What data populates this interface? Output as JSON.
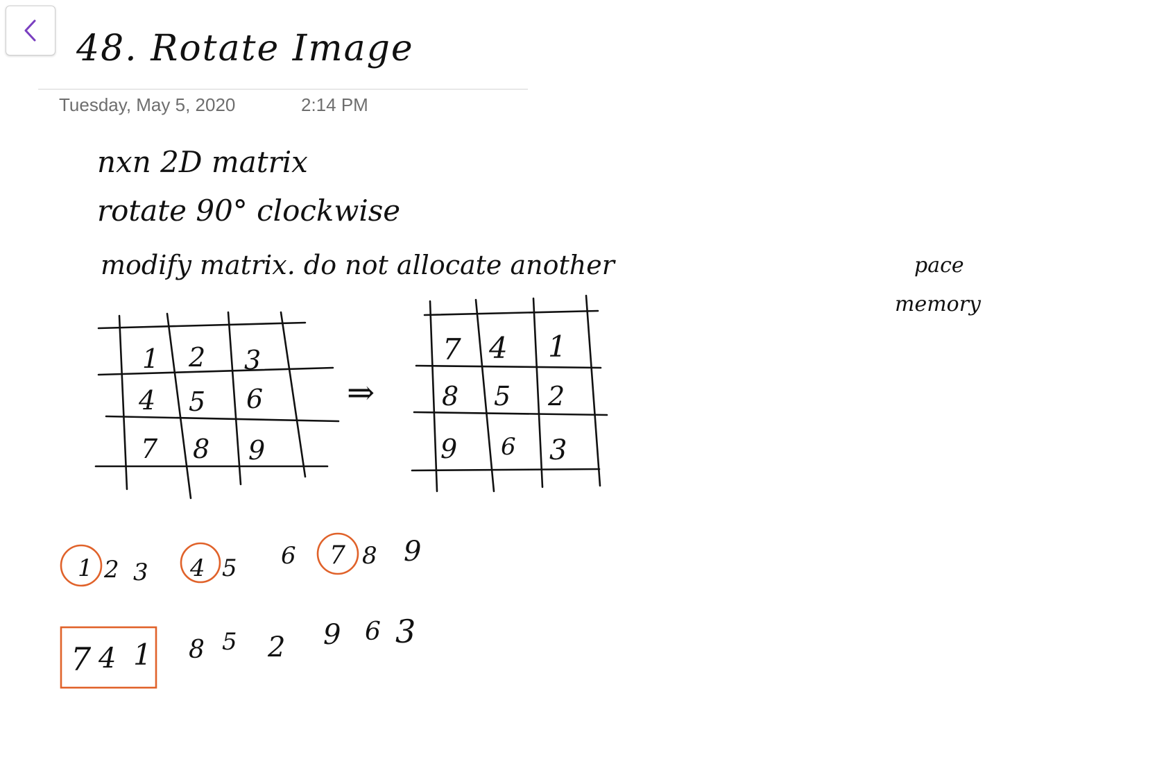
{
  "header": {
    "back_icon": "chevron-left-icon",
    "title": "48. Rotate Image",
    "date": "Tuesday, May 5, 2020",
    "time": "2:14 PM"
  },
  "notes": {
    "line1": "nxn  2D matrix",
    "line2": "rotate  90° clockwise",
    "line3": "modify matrix.  do not  allocate  another",
    "space_word": "pace",
    "memory_word": "memory",
    "arrow": "⇒"
  },
  "matrix_before": [
    [
      "1",
      "2",
      "3"
    ],
    [
      "4",
      "5",
      "6"
    ],
    [
      "7",
      "8",
      "9"
    ]
  ],
  "matrix_after": [
    [
      "7",
      "4",
      "1"
    ],
    [
      "8",
      "5",
      "2"
    ],
    [
      "9",
      "6",
      "3"
    ]
  ],
  "sequence_original": [
    "1",
    "2",
    "3",
    "4",
    "5",
    "6",
    "7",
    "8",
    "9"
  ],
  "sequence_rotated": [
    "7",
    "4",
    "1",
    "8",
    "5",
    "2",
    "9",
    "6",
    "3"
  ],
  "colors": {
    "accent": "#7a3fc0",
    "highlight": "#e0622a",
    "ink": "#111111",
    "meta_text": "#6e6e6e"
  }
}
